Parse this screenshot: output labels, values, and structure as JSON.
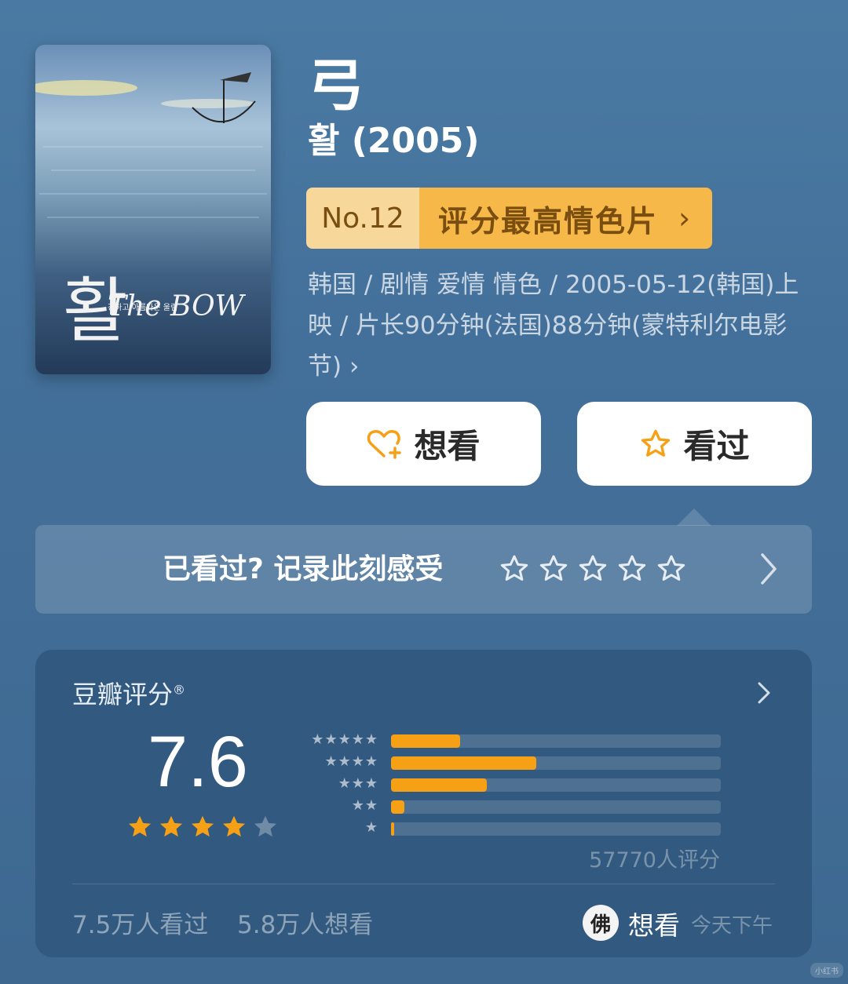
{
  "movie": {
    "title": "弓",
    "original_title": "활 (2005)",
    "poster": {
      "script_text": "활",
      "english_text": "The BOW",
      "tagline": "강하고 아름다운 울림"
    },
    "rank": {
      "number": "No.12",
      "list": "评分最高情色片",
      "chevron": "›"
    },
    "meta_text": "韩国 / 剧情 爱情 情色 / 2005-05-12(韩国)上映 / 片长90分钟(法国)88分钟(蒙特利尔电影节) ›"
  },
  "actions": {
    "want_label": "想看",
    "seen_label": "看过",
    "want_icon": "heart-plus-icon",
    "seen_icon": "star-outline-icon"
  },
  "rate_prompt": {
    "text": "已看过? 记录此刻感受",
    "star_count": 5
  },
  "rating": {
    "label": "豆瓣评分",
    "trademark": "®",
    "score": "7.6",
    "stars_filled": 4,
    "stars_total": 5,
    "distribution": [
      {
        "stars": 5,
        "fraction": 0.21
      },
      {
        "stars": 4,
        "fraction": 0.44
      },
      {
        "stars": 3,
        "fraction": 0.29
      },
      {
        "stars": 2,
        "fraction": 0.04
      },
      {
        "stars": 1,
        "fraction": 0.01
      }
    ],
    "count_text": "57770人评分",
    "watched_text": "7.5万人看过",
    "wishlist_text": "5.8万人想看"
  },
  "friend": {
    "avatar_char": "佛",
    "action": "想看",
    "time": "今天下午"
  },
  "watermark": "小红书",
  "colors": {
    "background": "#43709a",
    "accent_orange": "#f6a015",
    "badge_light": "#f7d79a",
    "badge_dark": "#f6b949"
  }
}
